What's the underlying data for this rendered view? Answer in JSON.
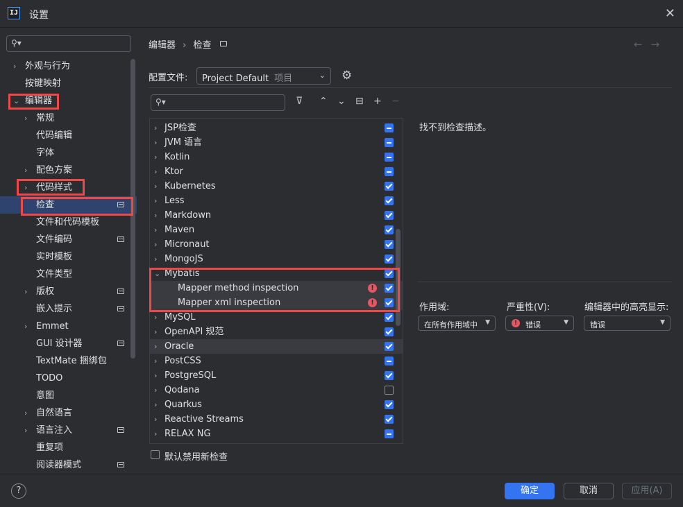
{
  "window": {
    "title": "设置",
    "icon_label": "IJ"
  },
  "sidebar": {
    "items": [
      {
        "label": "外观与行为",
        "chevron": "›",
        "pin": false
      },
      {
        "label": "按键映射",
        "chevron": "",
        "pin": false
      },
      {
        "label": "编辑器",
        "chevron": "⌄",
        "pin": false
      },
      {
        "label": "常规",
        "chevron": "›",
        "pin": false
      },
      {
        "label": "代码编辑",
        "chevron": "",
        "pin": false
      },
      {
        "label": "字体",
        "chevron": "",
        "pin": false
      },
      {
        "label": "配色方案",
        "chevron": "›",
        "pin": false
      },
      {
        "label": "代码样式",
        "chevron": "›",
        "pin": false
      },
      {
        "label": "检查",
        "chevron": "",
        "pin": true
      },
      {
        "label": "文件和代码模板",
        "chevron": "",
        "pin": false
      },
      {
        "label": "文件编码",
        "chevron": "",
        "pin": true
      },
      {
        "label": "实时模板",
        "chevron": "",
        "pin": false
      },
      {
        "label": "文件类型",
        "chevron": "",
        "pin": false
      },
      {
        "label": "版权",
        "chevron": "›",
        "pin": true
      },
      {
        "label": "嵌入提示",
        "chevron": "",
        "pin": true
      },
      {
        "label": "Emmet",
        "chevron": "›",
        "pin": false
      },
      {
        "label": "GUI 设计器",
        "chevron": "",
        "pin": true
      },
      {
        "label": "TextMate 捆绑包",
        "chevron": "",
        "pin": false
      },
      {
        "label": "TODO",
        "chevron": "",
        "pin": false
      },
      {
        "label": "意图",
        "chevron": "",
        "pin": false
      },
      {
        "label": "自然语言",
        "chevron": "›",
        "pin": false
      },
      {
        "label": "语言注入",
        "chevron": "›",
        "pin": true
      },
      {
        "label": "重复项",
        "chevron": "",
        "pin": false
      },
      {
        "label": "阅读器模式",
        "chevron": "",
        "pin": true
      }
    ]
  },
  "breadcrumb": {
    "parent": "编辑器",
    "sep": "›",
    "current": "检查"
  },
  "nav": {
    "back": "←",
    "forward": "→"
  },
  "profile": {
    "label": "配置文件:",
    "value": "Project Default",
    "scope": "项目"
  },
  "toolbar": {
    "filter": "⊽",
    "expand": "⌃",
    "collapse": "⌄",
    "reset": "⊟",
    "add": "+",
    "remove": "−"
  },
  "inspections": [
    {
      "label": "JSP检查",
      "state": "mixed",
      "expanded": false,
      "child": false
    },
    {
      "label": "JVM 语言",
      "state": "mixed",
      "expanded": false,
      "child": false
    },
    {
      "label": "Kotlin",
      "state": "mixed",
      "expanded": false,
      "child": false
    },
    {
      "label": "Ktor",
      "state": "mixed",
      "expanded": false,
      "child": false
    },
    {
      "label": "Kubernetes",
      "state": "checked",
      "expanded": false,
      "child": false
    },
    {
      "label": "Less",
      "state": "checked",
      "expanded": false,
      "child": false
    },
    {
      "label": "Markdown",
      "state": "checked",
      "expanded": false,
      "child": false
    },
    {
      "label": "Maven",
      "state": "checked",
      "expanded": false,
      "child": false
    },
    {
      "label": "Micronaut",
      "state": "checked",
      "expanded": false,
      "child": false
    },
    {
      "label": "MongoJS",
      "state": "checked",
      "expanded": false,
      "child": false
    },
    {
      "label": "Mybatis",
      "state": "checked",
      "expanded": true,
      "child": false
    },
    {
      "label": "Mapper method inspection",
      "state": "checked",
      "child": true,
      "error": true
    },
    {
      "label": "Mapper xml inspection",
      "state": "checked",
      "child": true,
      "error": true
    },
    {
      "label": "MySQL",
      "state": "checked",
      "expanded": false,
      "child": false
    },
    {
      "label": "OpenAPI 规范",
      "state": "checked",
      "expanded": false,
      "child": false
    },
    {
      "label": "Oracle",
      "state": "checked",
      "expanded": false,
      "child": false,
      "highlight": true
    },
    {
      "label": "PostCSS",
      "state": "mixed",
      "expanded": false,
      "child": false
    },
    {
      "label": "PostgreSQL",
      "state": "checked",
      "expanded": false,
      "child": false
    },
    {
      "label": "Qodana",
      "state": "empty",
      "expanded": false,
      "child": false
    },
    {
      "label": "Quarkus",
      "state": "checked",
      "expanded": false,
      "child": false
    },
    {
      "label": "Reactive Streams",
      "state": "checked",
      "expanded": false,
      "child": false
    },
    {
      "label": "RELAX NG",
      "state": "mixed",
      "expanded": false,
      "child": false
    }
  ],
  "disable_new": {
    "label": "默认禁用新检查",
    "checked": false
  },
  "description": {
    "text": "找不到检查描述。"
  },
  "options": {
    "scope_label": "作用域:",
    "scope_value": "在所有作用域中",
    "severity_label": "严重性(V):",
    "severity_value": "错误",
    "highlight_label": "编辑器中的高亮显示:",
    "highlight_value": "错误"
  },
  "footer": {
    "help": "?",
    "ok": "确定",
    "cancel": "取消",
    "apply": "应用(A)"
  },
  "colors": {
    "accent": "#3574f0",
    "annotation": "#f04848",
    "error": "#e55765"
  }
}
